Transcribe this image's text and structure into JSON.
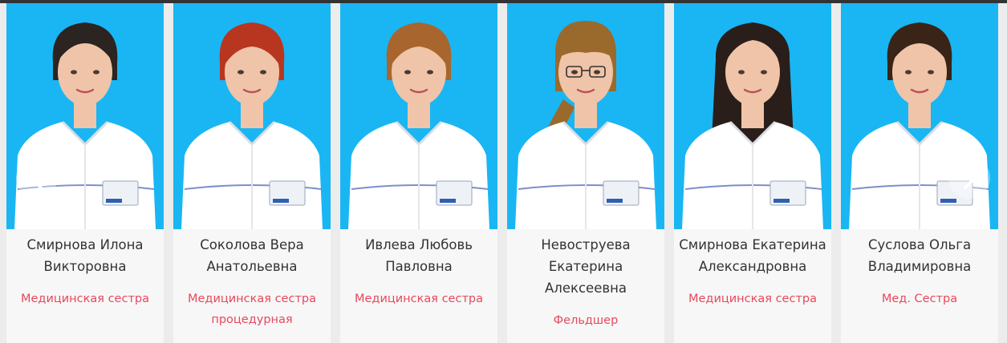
{
  "staff": [
    {
      "name_line1": "Смирнова Илона",
      "name_line2": "Викторовна",
      "name_line3": "",
      "role_line1": "Медицинская сестра",
      "role_line2": "",
      "hair": "#2b2420",
      "hair_style": "bun"
    },
    {
      "name_line1": "Соколова Вера",
      "name_line2": "Анатольевна",
      "name_line3": "",
      "role_line1": "Медицинская сестра",
      "role_line2": "процедурная",
      "hair": "#b8361f",
      "hair_style": "short"
    },
    {
      "name_line1": "Ивлева Любовь",
      "name_line2": "Павловна",
      "name_line3": "",
      "role_line1": "Медицинская сестра",
      "role_line2": "",
      "hair": "#a8662e",
      "hair_style": "short"
    },
    {
      "name_line1": "Невоструева",
      "name_line2": "Екатерина",
      "name_line3": "Алексеевна",
      "role_line1": "Фельдшер",
      "role_line2": "",
      "hair": "#9a6a2c",
      "hair_style": "braid"
    },
    {
      "name_line1": "Смирнова Екатерина",
      "name_line2": "Александровна",
      "name_line3": "",
      "role_line1": "Медицинская сестра",
      "role_line2": "",
      "hair": "#2a1e1a",
      "hair_style": "long"
    },
    {
      "name_line1": "Суслова Ольга",
      "name_line2": "Владимировна",
      "name_line3": "",
      "role_line1": "Мед. Сестра",
      "role_line2": "",
      "hair": "#3a2418",
      "hair_style": "bun"
    }
  ],
  "nav": {
    "prev_icon": "chevron-left-icon",
    "next_icon": "chevron-right-icon"
  },
  "colors": {
    "photo_background": "#19b6f3",
    "role_text": "#e8485e",
    "name_text": "#333333",
    "card_background": "#f7f7f7"
  }
}
